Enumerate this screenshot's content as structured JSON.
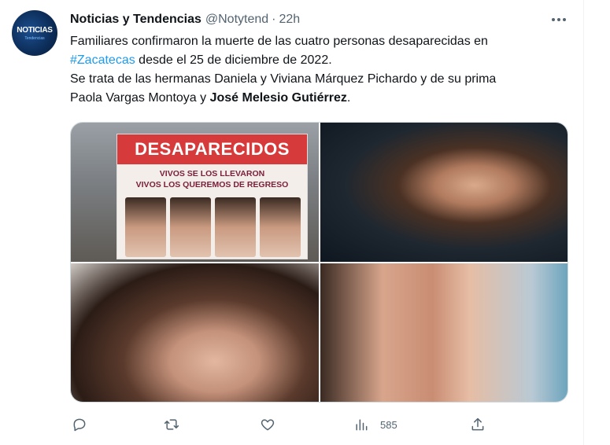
{
  "tweet": {
    "author_name": "Noticias y Tendencias",
    "author_handle": "@Notytend",
    "separator": "·",
    "time": "22h",
    "avatar_text": "NOTICIAS",
    "avatar_subtext": "Tendencias",
    "text": {
      "line1": "Familiares confirmaron la muerte de las cuatro personas desaparecidas en",
      "hashtag": "#Zacatecas",
      "line2_rest": " desde el 25 de diciembre de 2022.",
      "line3": "Se trata de las hermanas Daniela y Viviana Márquez Pichardo y de su prima",
      "line4_start": "Paola Vargas Montoya y ",
      "line4_bold": "José Melesio Gutiérrez",
      "line4_end": "."
    },
    "banner": {
      "title": "DESAPARECIDOS",
      "line1": "VIVOS SE LOS LLEVARON",
      "line2": "VIVOS LOS QUEREMOS DE REGRESO"
    },
    "actions": {
      "reply_count": "",
      "retweet_count": "",
      "like_count": "",
      "views_count": "585"
    }
  },
  "icons": {
    "more": "more-horizontal-icon",
    "reply": "reply-icon",
    "retweet": "retweet-icon",
    "like": "heart-icon",
    "views": "analytics-icon",
    "share": "share-icon"
  },
  "colors": {
    "accent": "#1d9bf0",
    "text": "#0f1419",
    "secondary": "#536471",
    "banner_red": "#d63a3a"
  }
}
